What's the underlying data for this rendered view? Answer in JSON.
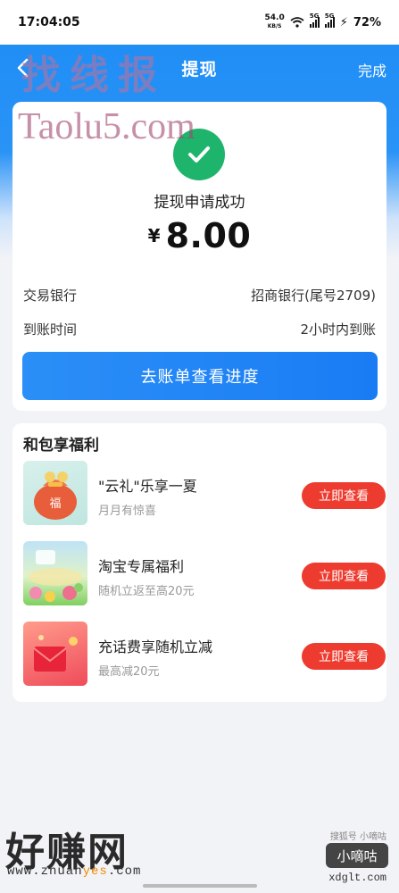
{
  "status_bar": {
    "time": "17:04:05",
    "net_speed_value": "54.0",
    "net_speed_unit": "KB/S",
    "network_tag_1": "5G",
    "network_tag_2": "5G",
    "battery": "72%"
  },
  "nav": {
    "title": "提现",
    "done_label": "完成"
  },
  "success": {
    "title": "提现申请成功",
    "currency_symbol": "¥",
    "amount": "8.00",
    "bank_label": "交易银行",
    "bank_value": "招商银行(尾号2709)",
    "arrival_label": "到账时间",
    "arrival_value": "2小时内到账",
    "progress_button": "去账单查看进度"
  },
  "benefits": {
    "title": "和包享福利",
    "items": [
      {
        "name": "\"云礼\"乐享一夏",
        "desc": "月月有惊喜",
        "button": "立即查看",
        "image_text": "福"
      },
      {
        "name": "淘宝专属福利",
        "desc": "随机立返至高20元",
        "button": "立即查看"
      },
      {
        "name": "充话费享随机立减",
        "desc": "最高减20元",
        "button": "立即查看"
      }
    ]
  },
  "watermarks": {
    "top_1": "找线报",
    "top_2": "Taolu5.com",
    "bottom_left_1": "好赚网",
    "bottom_left_2_a": "www.zhuan",
    "bottom_left_2_b": "yes",
    "bottom_left_2_c": ".com",
    "bottom_right_sub": "搜狐号 小嘀咕",
    "bottom_right_box": "小嘀咕",
    "bottom_right_url": "xdglt.com"
  },
  "colors": {
    "header_blue": "#1a8cf5",
    "success_green": "#1fb46b",
    "primary_button": "#1a7cf4",
    "view_button_red": "#ee3b2f"
  }
}
